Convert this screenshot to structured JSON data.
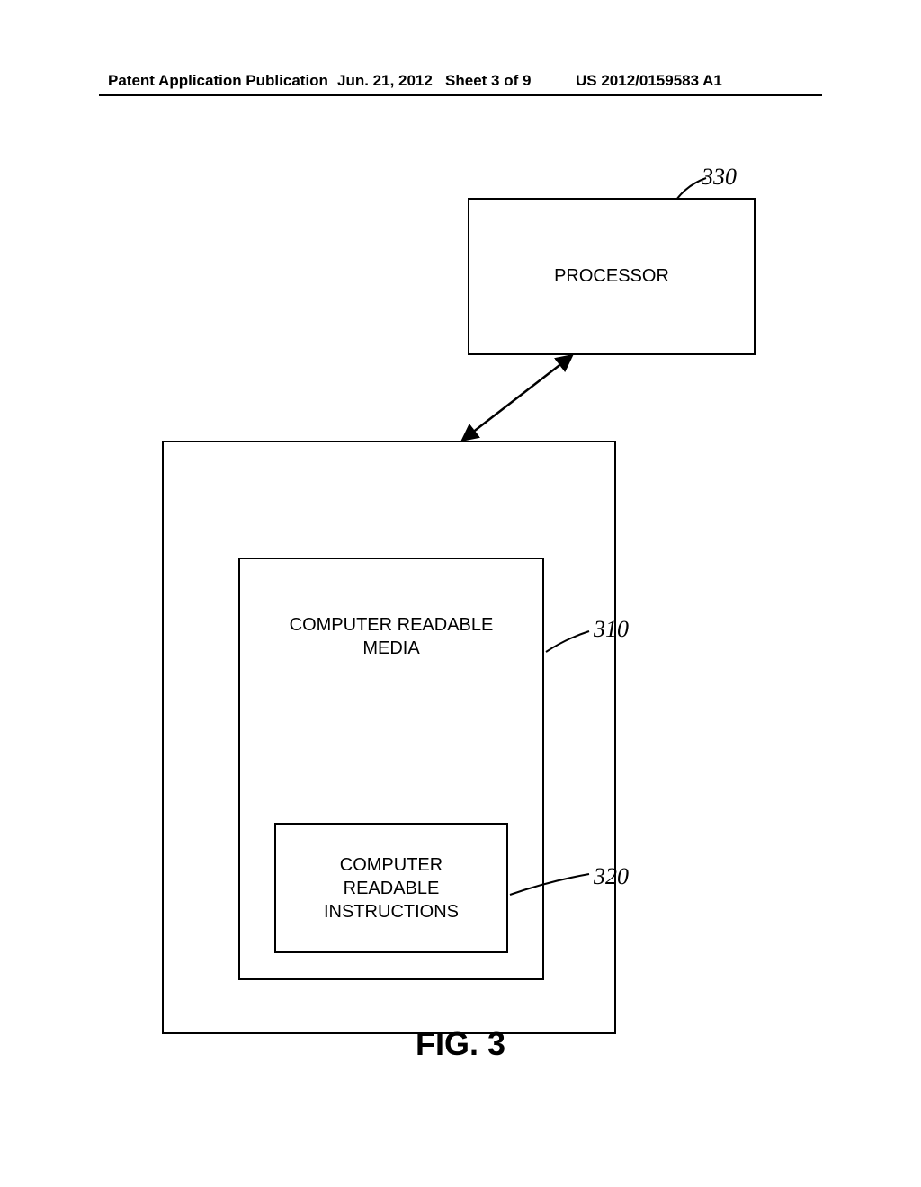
{
  "header": {
    "publication": "Patent Application Publication",
    "date": "Jun. 21, 2012",
    "sheet": "Sheet 3 of 9",
    "pubnum": "US 2012/0159583 A1"
  },
  "blocks": {
    "processor": "PROCESSOR",
    "media": "COMPUTER READABLE\nMEDIA",
    "instructions": "COMPUTER\nREADABLE\nINSTRUCTIONS"
  },
  "refs": {
    "r330": "330",
    "r310": "310",
    "r320": "320"
  },
  "figure": "FIG. 3"
}
